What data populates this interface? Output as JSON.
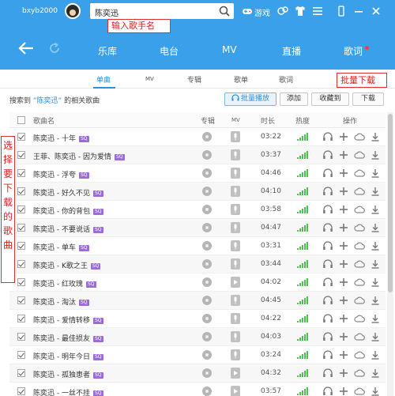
{
  "titlebar": {
    "username": "bxyb2000",
    "search_value": "陈奕迅",
    "game_label": "游戏"
  },
  "annotations": {
    "search_hint": "输入歌手名",
    "batch_download_hint": "批量下载",
    "select_hint": "选择要下载的歌曲"
  },
  "nav": {
    "items": [
      "乐库",
      "电台",
      "MV",
      "直播",
      "歌词"
    ]
  },
  "tabs": [
    "单曲",
    "MV",
    "专辑",
    "歌单",
    "歌词"
  ],
  "result": {
    "prefix": "搜索到",
    "keyword": "“陈奕迅”",
    "suffix": "的相关歌曲"
  },
  "toolbar": {
    "play_all_label": "批量播放",
    "add_label": "添加",
    "collect_label": "收藏到",
    "download_label": "下载"
  },
  "table": {
    "columns": {
      "name": "歌曲名",
      "album": "专辑",
      "mv": "MV",
      "duration": "时长",
      "heat": "热度",
      "actions": "操作"
    },
    "rows": [
      {
        "name": "陈奕迅 - 十年",
        "badge": "SQ",
        "duration": "03:22",
        "heat": 5,
        "mv": "mic",
        "checked": true
      },
      {
        "name": "王菲、陈奕迅 - 因为爱情",
        "badge": "SQ",
        "duration": "03:37",
        "heat": 5,
        "mv": "mic",
        "checked": true
      },
      {
        "name": "陈奕迅 - 浮夸",
        "badge": "SQ",
        "duration": "04:46",
        "heat": 5,
        "mv": "mic",
        "checked": true
      },
      {
        "name": "陈奕迅 - 好久不见",
        "badge": "SQ",
        "duration": "04:10",
        "heat": 5,
        "mv": "mic",
        "checked": true
      },
      {
        "name": "陈奕迅 - 你的背包",
        "badge": "SQ",
        "duration": "03:58",
        "heat": 5,
        "mv": "mic",
        "checked": true
      },
      {
        "name": "陈奕迅 - 不要说话",
        "badge": "SQ",
        "duration": "04:47",
        "heat": 5,
        "mv": "mic",
        "checked": true
      },
      {
        "name": "陈奕迅 - 单车",
        "badge": "SQ",
        "duration": "03:31",
        "heat": 5,
        "mv": "mic",
        "checked": true
      },
      {
        "name": "陈奕迅 - K歌之王",
        "badge": "SQ",
        "duration": "03:44",
        "heat": 5,
        "mv": "mic",
        "checked": true
      },
      {
        "name": "陈奕迅 - 红玫瑰",
        "badge": "SQ",
        "duration": "04:02",
        "heat": 5,
        "mv": "play",
        "checked": true
      },
      {
        "name": "陈奕迅 - 淘汰",
        "badge": "SQ",
        "duration": "04:45",
        "heat": 5,
        "mv": "mic",
        "checked": true
      },
      {
        "name": "陈奕迅 - 爱情转移",
        "badge": "SQ",
        "duration": "04:22",
        "heat": 5,
        "mv": "mic",
        "checked": true
      },
      {
        "name": "陈奕迅 - 最佳损友",
        "badge": "SQ",
        "duration": "04:03",
        "heat": 5,
        "mv": "mic",
        "checked": true
      },
      {
        "name": "陈奕迅 - 明年今日",
        "badge": "SQ",
        "duration": "03:24",
        "heat": 5,
        "mv": "mic",
        "checked": true
      },
      {
        "name": "陈奕迅 - 孤独患者",
        "badge": "SQ",
        "duration": "04:32",
        "heat": 5,
        "mv": "play",
        "checked": true
      },
      {
        "name": "陈奕迅 - 一丝不挂",
        "badge": "SQ",
        "duration": "03:57",
        "heat": 5,
        "mv": "play",
        "checked": true
      }
    ]
  },
  "colors": {
    "header_blue": "#3aa0ea",
    "accent_blue": "#2d8ee0",
    "heat_green": "#4ec24e",
    "sq_purple": "#9b6bd6",
    "annotation_red": "#e02020"
  }
}
